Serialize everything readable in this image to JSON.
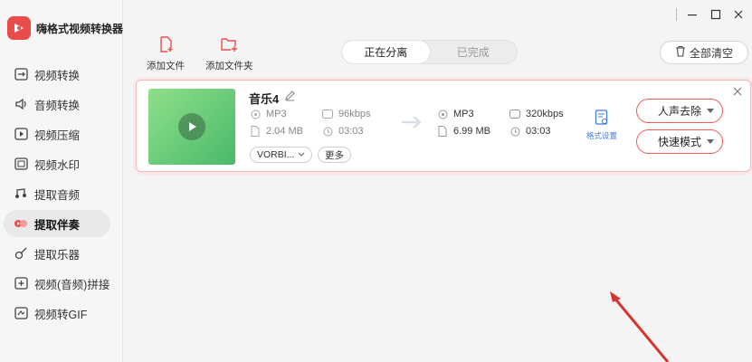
{
  "app": {
    "title": "嗨格式视频转换器"
  },
  "colors": {
    "accent": "#ea4c4c",
    "select_border": "#ee5a5a",
    "link_blue": "#3f7cd8"
  },
  "sidebar": {
    "items": [
      {
        "label": "视频转换",
        "icon": "video-convert-icon",
        "active": false
      },
      {
        "label": "音频转换",
        "icon": "audio-convert-icon",
        "active": false
      },
      {
        "label": "视频压缩",
        "icon": "video-compress-icon",
        "active": false
      },
      {
        "label": "视频水印",
        "icon": "watermark-icon",
        "active": false
      },
      {
        "label": "提取音频",
        "icon": "extract-audio-icon",
        "active": false
      },
      {
        "label": "提取伴奏",
        "icon": "extract-accompaniment-icon",
        "active": true
      },
      {
        "label": "提取乐器",
        "icon": "guitar-icon",
        "active": false
      },
      {
        "label": "视频(音频)拼接",
        "icon": "merge-icon",
        "active": false
      },
      {
        "label": "视频转GIF",
        "icon": "gif-icon",
        "active": false
      }
    ]
  },
  "toolbar": {
    "add_file": "添加文件",
    "add_folder": "添加文件夹",
    "tabs": [
      {
        "label": "正在分离",
        "active": true
      },
      {
        "label": "已完成",
        "active": false
      }
    ],
    "clear_all": "全部清空"
  },
  "file": {
    "name": "音乐4",
    "source": {
      "format": "MP3",
      "bitrate": "96kbps",
      "size": "2.04 MB",
      "duration": "03:03"
    },
    "output": {
      "format": "MP3",
      "bitrate": "320kbps",
      "size": "6.99 MB",
      "duration": "03:03"
    },
    "codec": "VORBI...",
    "more": "更多",
    "format_settings": "格式设置",
    "mode_select": "人声去除",
    "speed_select": "快速模式"
  }
}
